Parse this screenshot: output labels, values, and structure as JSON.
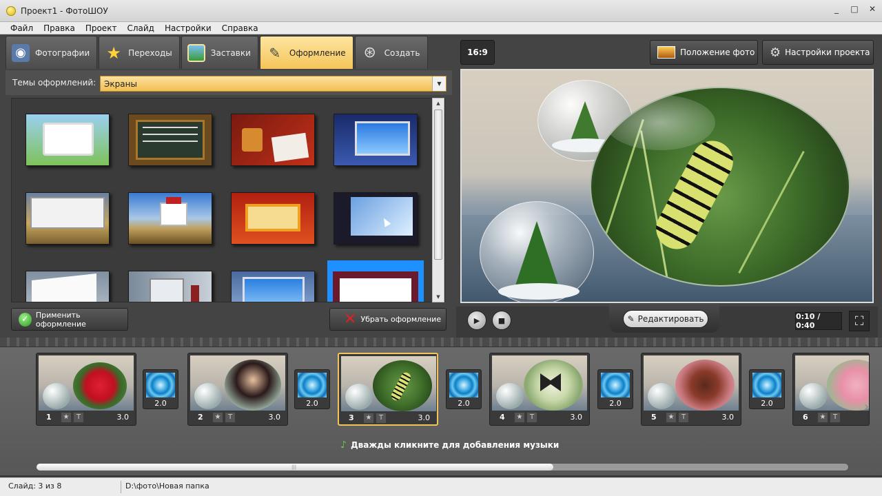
{
  "window": {
    "title": "Проект1 - ФотоШОУ",
    "controls": [
      "_",
      "□",
      "✕"
    ]
  },
  "menu": [
    "Файл",
    "Правка",
    "Проект",
    "Слайд",
    "Настройки",
    "Справка"
  ],
  "tabs": [
    {
      "label": "Фотографии",
      "icon": "camera-icon"
    },
    {
      "label": "Переходы",
      "icon": "star-icon"
    },
    {
      "label": "Заставки",
      "icon": "picture-icon"
    },
    {
      "label": "Оформление",
      "icon": "brush-icon",
      "active": true
    },
    {
      "label": "Создать",
      "icon": "film-reel-icon"
    }
  ],
  "themes": {
    "label": "Темы оформлений:",
    "selected": "Экраны"
  },
  "buttons": {
    "apply": "Применить оформление",
    "remove": "Убрать оформление"
  },
  "preview": {
    "aspect": "16:9",
    "photo_position": "Положение фото",
    "project_settings": "Настройки проекта",
    "edit": "Редактировать",
    "time": "0:10 / 0:40"
  },
  "slides": [
    {
      "num": "1",
      "duration": "3.0",
      "transition": "2.0",
      "subject": "red flower"
    },
    {
      "num": "2",
      "duration": "3.0",
      "transition": "2.0",
      "subject": "woman"
    },
    {
      "num": "3",
      "duration": "3.0",
      "transition": "2.0",
      "subject": "caterpillar",
      "selected": true
    },
    {
      "num": "4",
      "duration": "3.0",
      "transition": "2.0",
      "subject": "butterfly"
    },
    {
      "num": "5",
      "duration": "3.0",
      "transition": "2.0",
      "subject": "ladybug"
    },
    {
      "num": "6",
      "duration": "",
      "transition": "",
      "subject": "pink flower"
    }
  ],
  "timeline": {
    "music_hint": "Дважды кликните для добавления музыки"
  },
  "status": {
    "slide": "Слайд: 3 из 8",
    "path": "D:\\фото\\Новая папка"
  },
  "colors": {
    "accent": "#f5c45a",
    "dark_bg": "#444444",
    "selection_blue": "#1e90ff"
  }
}
